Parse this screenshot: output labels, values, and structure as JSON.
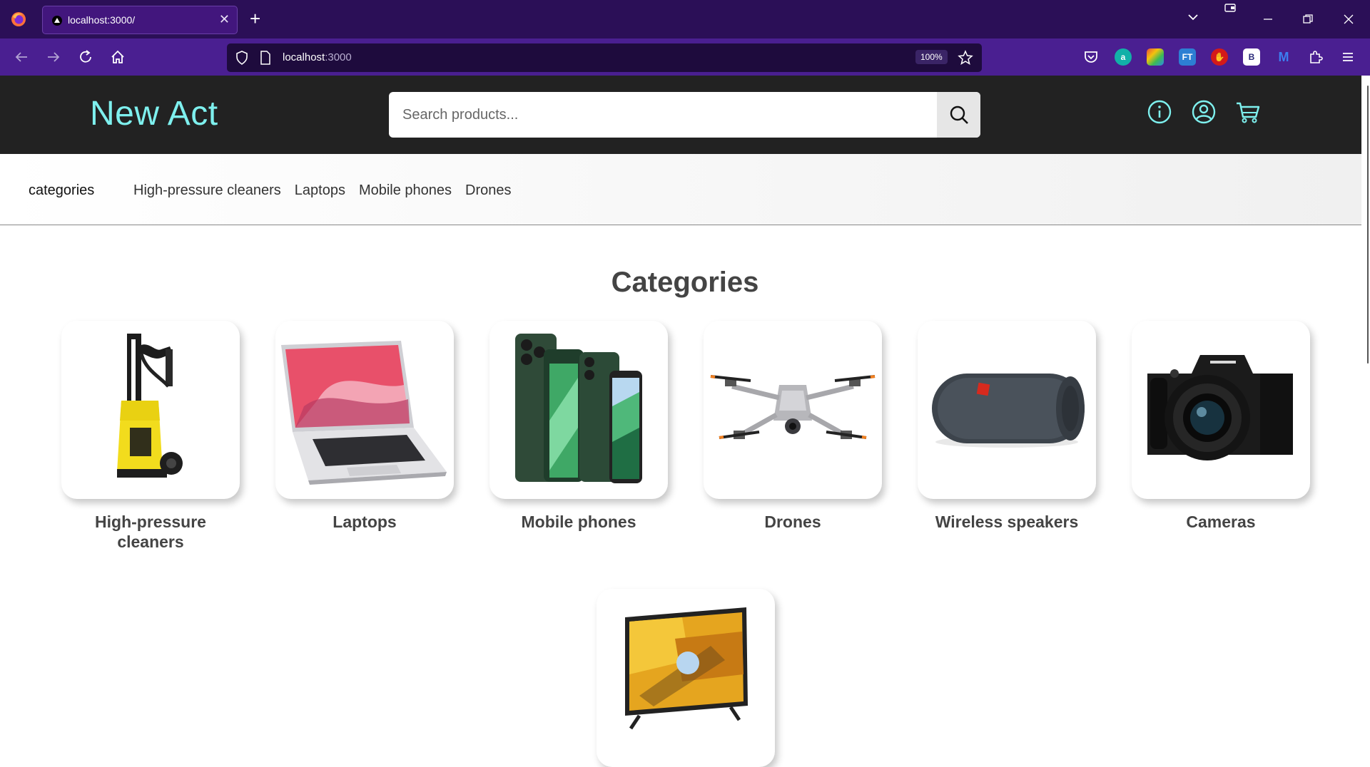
{
  "browser": {
    "tab_title": "localhost:3000/",
    "url_host": "localhost",
    "url_port": ":3000",
    "zoom": "100%",
    "accent": "#4a1f91"
  },
  "site": {
    "brand": "New Act",
    "search_placeholder": "Search products...",
    "brand_color": "#7ef0ee",
    "icons": [
      "info-icon",
      "user-icon",
      "cart-icon"
    ]
  },
  "category_bar": {
    "title": "categories",
    "links": [
      "High-pressure cleaners",
      "Laptops",
      "Mobile phones",
      "Drones"
    ]
  },
  "main": {
    "title": "Categories",
    "categories": [
      {
        "label": "High-pressure cleaners",
        "icon": "pressure-washer-image"
      },
      {
        "label": "Laptops",
        "icon": "laptop-image"
      },
      {
        "label": "Mobile phones",
        "icon": "phones-image"
      },
      {
        "label": "Drones",
        "icon": "drone-image"
      },
      {
        "label": "Wireless speakers",
        "icon": "speaker-image"
      },
      {
        "label": "Cameras",
        "icon": "camera-image"
      },
      {
        "label": "",
        "icon": "tv-image"
      }
    ]
  }
}
